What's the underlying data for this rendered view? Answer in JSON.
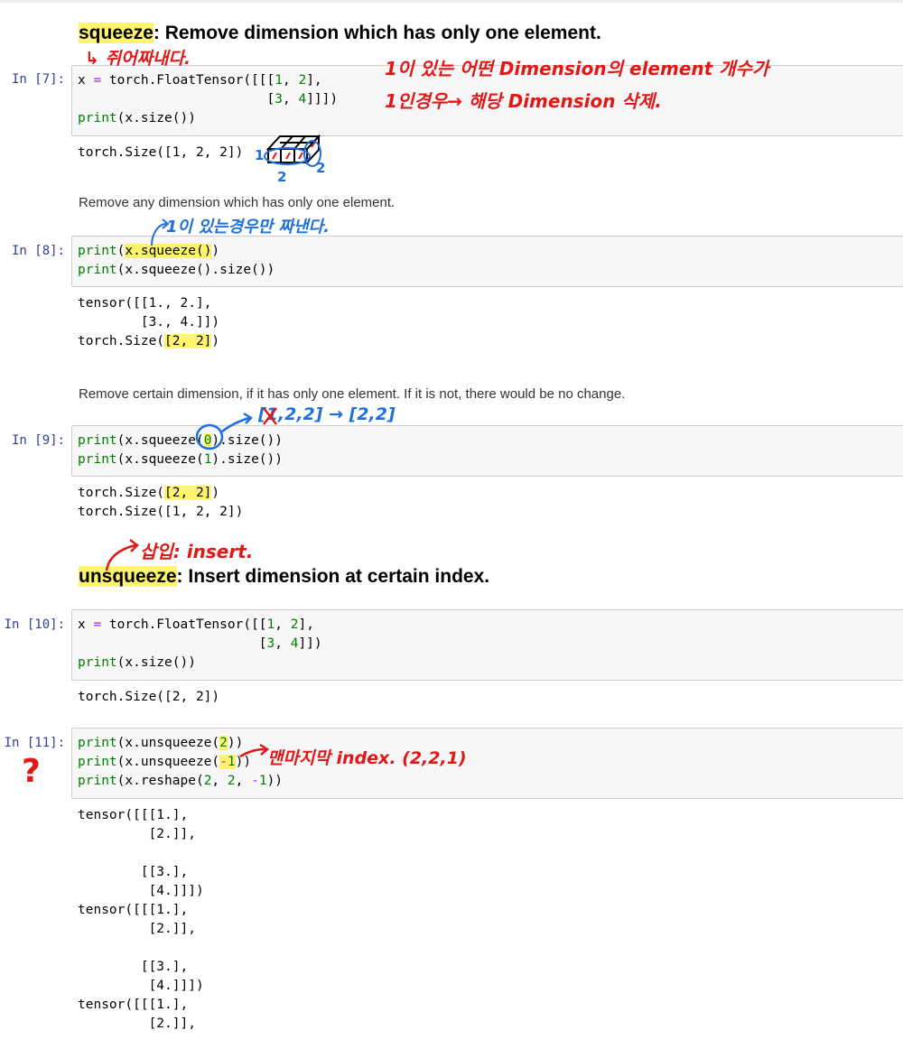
{
  "headers": {
    "squeeze": {
      "keyword": "squeeze",
      "rest": ": Remove dimension which has only one element."
    },
    "unsqueeze": {
      "keyword": "unsqueeze",
      "rest": ": Insert dimension at certain index."
    }
  },
  "paragraphs": {
    "p1": "Remove any dimension which has only one element.",
    "p2": "Remove certain dimension, if it has only one element. If it is not, there would be no change."
  },
  "prompts": {
    "c7": "In [7]:",
    "c8": "In [8]:",
    "c9": "In [9]:",
    "c10": "In [10]:",
    "c11": "In [11]:"
  },
  "cells": {
    "c7": {
      "code": [
        "x = torch.FloatTensor([[[1, 2],",
        "                        [3, 4]]])",
        "print(x.size())"
      ],
      "output": [
        "torch.Size([1, 2, 2])"
      ]
    },
    "c8": {
      "code": [
        "print(x.squeeze())",
        "print(x.squeeze().size())"
      ],
      "output": [
        "tensor([[1., 2.],",
        "        [3., 4.]])",
        "torch.Size([2, 2])"
      ]
    },
    "c9": {
      "code": [
        "print(x.squeeze(0).size())",
        "print(x.squeeze(1).size())"
      ],
      "output": [
        "torch.Size([2, 2])",
        "torch.Size([1, 2, 2])"
      ]
    },
    "c10": {
      "code": [
        "x = torch.FloatTensor([[1, 2],",
        "                       [3, 4]])",
        "print(x.size())"
      ],
      "output": [
        "torch.Size([2, 2])"
      ]
    },
    "c11": {
      "code": [
        "print(x.unsqueeze(2))",
        "print(x.unsqueeze(-1))",
        "print(x.reshape(2, 2, -1))"
      ],
      "output": [
        "tensor([[[1.],",
        "         [2.]],",
        "",
        "        [[3.],",
        "         [4.]]])",
        "tensor([[[1.],",
        "         [2.]],",
        "",
        "        [[3.],",
        "         [4.]]])",
        "tensor([[[1.],",
        "         [2.]],"
      ]
    }
  },
  "annotations": {
    "squeeze_meaning": "↳ 쥐어짜내다.",
    "note_line1": "1이 있는 어떤 Dimension의 element 개수가",
    "note_line2": "1인경우→ 해당 Dimension 삭제.",
    "only_if_one": "1이 있는경우만 짜낸다.",
    "squeeze0_note": "[1,2,2] → [2,2]",
    "dims_left": "1",
    "dims_bottom": "2",
    "dims_right": "2",
    "insert_note": "삽입: insert.",
    "last_index_note": "맨마지막 index. (2,2,1)",
    "question": "?"
  },
  "colors": {
    "annotation_red": "#e01818",
    "annotation_blue": "#1f6fdc",
    "highlight": "#fff03c",
    "prompt": "#303f9f"
  }
}
